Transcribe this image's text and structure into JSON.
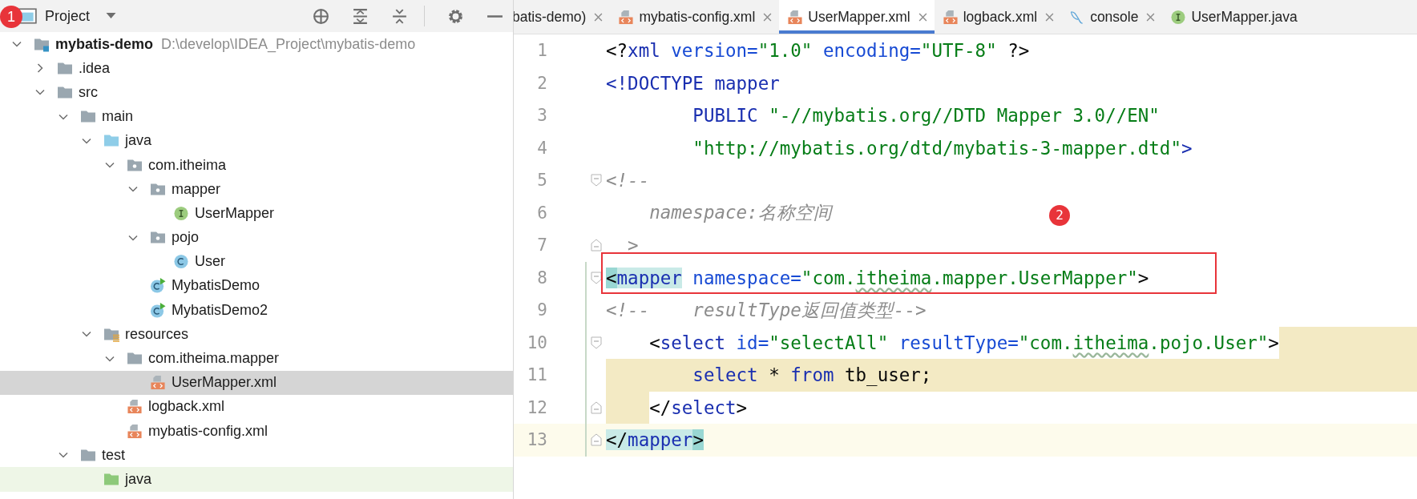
{
  "project_panel": {
    "title": "Project",
    "badge": "1",
    "tree": [
      {
        "label": "mybatis-demo",
        "path": "D:\\develop\\IDEA_Project\\mybatis-demo",
        "kind": "module",
        "expanded": true,
        "selected": false,
        "children": [
          {
            "label": ".idea",
            "kind": "folder",
            "expanded": false,
            "selected": false
          },
          {
            "label": "src",
            "kind": "folder",
            "expanded": true,
            "selected": false,
            "children": [
              {
                "label": "main",
                "kind": "folder",
                "expanded": true,
                "selected": false,
                "children": [
                  {
                    "label": "java",
                    "kind": "source-folder",
                    "expanded": true,
                    "selected": false,
                    "children": [
                      {
                        "label": "com.itheima",
                        "kind": "package",
                        "expanded": true,
                        "selected": false,
                        "children": [
                          {
                            "label": "mapper",
                            "kind": "package",
                            "expanded": true,
                            "selected": false,
                            "children": [
                              {
                                "label": "UserMapper",
                                "kind": "interface",
                                "selected": false
                              }
                            ]
                          },
                          {
                            "label": "pojo",
                            "kind": "package",
                            "expanded": true,
                            "selected": false,
                            "children": [
                              {
                                "label": "User",
                                "kind": "class",
                                "selected": false
                              }
                            ]
                          },
                          {
                            "label": "MybatisDemo",
                            "kind": "runnable-class",
                            "selected": false
                          },
                          {
                            "label": "MybatisDemo2",
                            "kind": "runnable-class",
                            "selected": false
                          }
                        ]
                      }
                    ]
                  },
                  {
                    "label": "resources",
                    "kind": "resources-folder",
                    "expanded": true,
                    "selected": false,
                    "children": [
                      {
                        "label": "com.itheima.mapper",
                        "kind": "folder",
                        "expanded": true,
                        "selected": false,
                        "children": [
                          {
                            "label": "UserMapper.xml",
                            "kind": "xml",
                            "selected": true
                          }
                        ]
                      },
                      {
                        "label": "logback.xml",
                        "kind": "xml",
                        "selected": false
                      },
                      {
                        "label": "mybatis-config.xml",
                        "kind": "xml",
                        "selected": false
                      }
                    ]
                  }
                ]
              },
              {
                "label": "test",
                "kind": "folder",
                "expanded": true,
                "selected": false,
                "children": [
                  {
                    "label": "java",
                    "kind": "test-folder",
                    "selected": false
                  }
                ]
              }
            ]
          }
        ]
      }
    ]
  },
  "editor_tabs": [
    {
      "label": "batis-demo)",
      "kind": "plain",
      "selected": false,
      "closable": true
    },
    {
      "label": "mybatis-config.xml",
      "kind": "xml",
      "selected": false,
      "closable": true
    },
    {
      "label": "UserMapper.xml",
      "kind": "xml",
      "selected": true,
      "closable": true
    },
    {
      "label": "logback.xml",
      "kind": "xml",
      "selected": false,
      "closable": true
    },
    {
      "label": "console",
      "kind": "console",
      "selected": false,
      "closable": true
    },
    {
      "label": "UserMapper.java",
      "kind": "interface",
      "selected": false,
      "closable": false
    }
  ],
  "editor": {
    "lines": [
      {
        "number": "1",
        "kind": "plain",
        "fold_open": false,
        "fold_close": false,
        "changed": false,
        "boxed": false,
        "tokens": [
          {
            "text": "<?",
            "kind": "plain"
          },
          {
            "text": "xml",
            "kind": "tag"
          },
          {
            "text": " version=",
            "kind": "attr"
          },
          {
            "text": "\"1.0\"",
            "kind": "value"
          },
          {
            "text": " encoding=",
            "kind": "attr"
          },
          {
            "text": "\"UTF-8\"",
            "kind": "value"
          },
          {
            "text": " ?>",
            "kind": "plain"
          }
        ]
      },
      {
        "number": "2",
        "kind": "plain",
        "fold_open": false,
        "fold_close": false,
        "changed": false,
        "boxed": false,
        "tokens": [
          {
            "text": "<!DOCTYPE mapper",
            "kind": "tag"
          }
        ]
      },
      {
        "number": "3",
        "kind": "plain",
        "fold_open": false,
        "fold_close": false,
        "changed": false,
        "boxed": false,
        "tokens": [
          {
            "text": "        PUBLIC ",
            "kind": "tag"
          },
          {
            "text": "\"-//mybatis.org//DTD Mapper 3.0//EN\"",
            "kind": "value"
          }
        ]
      },
      {
        "number": "4",
        "kind": "plain",
        "fold_open": false,
        "fold_close": false,
        "changed": false,
        "boxed": false,
        "tokens": [
          {
            "text": "        \"http://mybatis.org/dtd/mybatis-3-mapper.dtd\"",
            "kind": "value"
          },
          {
            "text": ">",
            "kind": "tag"
          }
        ]
      },
      {
        "number": "5",
        "kind": "plain",
        "fold_open": true,
        "fold_close": false,
        "changed": false,
        "boxed": false,
        "tokens": [
          {
            "text": "<!--",
            "kind": "comment"
          }
        ]
      },
      {
        "number": "6",
        "kind": "plain",
        "fold_open": false,
        "fold_close": false,
        "changed": false,
        "boxed": false,
        "badge": "2",
        "tokens": [
          {
            "text": "    namespace:名称空间",
            "kind": "comment"
          }
        ]
      },
      {
        "number": "7",
        "kind": "plain",
        "fold_open": false,
        "fold_close": true,
        "changed": false,
        "boxed": false,
        "tokens": [
          {
            "text": "  >",
            "kind": "comment"
          }
        ]
      },
      {
        "number": "8",
        "kind": "plain",
        "fold_open": true,
        "fold_close": false,
        "changed": true,
        "boxed": true,
        "tokens": [
          {
            "text": "<",
            "kind": "match-strong"
          },
          {
            "text": "mapper",
            "kind": "match-tag"
          },
          {
            "text": " namespace=",
            "kind": "attr"
          },
          {
            "text": "\"com.",
            "kind": "value"
          },
          {
            "text": "itheima",
            "kind": "value-typo"
          },
          {
            "text": ".mapper.UserMapper\"",
            "kind": "value"
          },
          {
            "text": ">",
            "kind": "plain"
          }
        ]
      },
      {
        "number": "9",
        "kind": "plain",
        "fold_open": false,
        "fold_close": false,
        "changed": true,
        "boxed": false,
        "tokens": [
          {
            "text": "<!--    resultType返回值类型-->",
            "kind": "comment"
          }
        ]
      },
      {
        "number": "10",
        "kind": "sql-tail",
        "fold_open": true,
        "fold_close": false,
        "changed": true,
        "boxed": false,
        "tokens": [
          {
            "text": "    <",
            "kind": "plain"
          },
          {
            "text": "select",
            "kind": "tag"
          },
          {
            "text": " id=",
            "kind": "attr"
          },
          {
            "text": "\"selectAll\"",
            "kind": "value"
          },
          {
            "text": " resultType=",
            "kind": "attr"
          },
          {
            "text": "\"com.",
            "kind": "value"
          },
          {
            "text": "itheima",
            "kind": "value-typo"
          },
          {
            "text": ".pojo.User\"",
            "kind": "value"
          },
          {
            "text": ">",
            "kind": "plain"
          }
        ]
      },
      {
        "number": "11",
        "kind": "sql-body",
        "fold_open": false,
        "fold_close": false,
        "changed": true,
        "boxed": false,
        "tokens": [
          {
            "text": "        select",
            "kind": "keyword"
          },
          {
            "text": " * ",
            "kind": "plain"
          },
          {
            "text": "from",
            "kind": "keyword"
          },
          {
            "text": " tb_user;",
            "kind": "plain"
          }
        ]
      },
      {
        "number": "12",
        "kind": "sql-close",
        "fold_open": false,
        "fold_close": true,
        "changed": true,
        "boxed": false,
        "tokens": [
          {
            "text": "</",
            "kind": "plain"
          },
          {
            "text": "select",
            "kind": "tag"
          },
          {
            "text": ">",
            "kind": "plain"
          }
        ]
      },
      {
        "number": "13",
        "kind": "current",
        "fold_open": false,
        "fold_close": true,
        "changed": true,
        "boxed": false,
        "tokens": [
          {
            "text": "</",
            "kind": "match"
          },
          {
            "text": "mapper",
            "kind": "match-tag"
          },
          {
            "text": ">",
            "kind": "match-strong"
          }
        ]
      }
    ]
  }
}
